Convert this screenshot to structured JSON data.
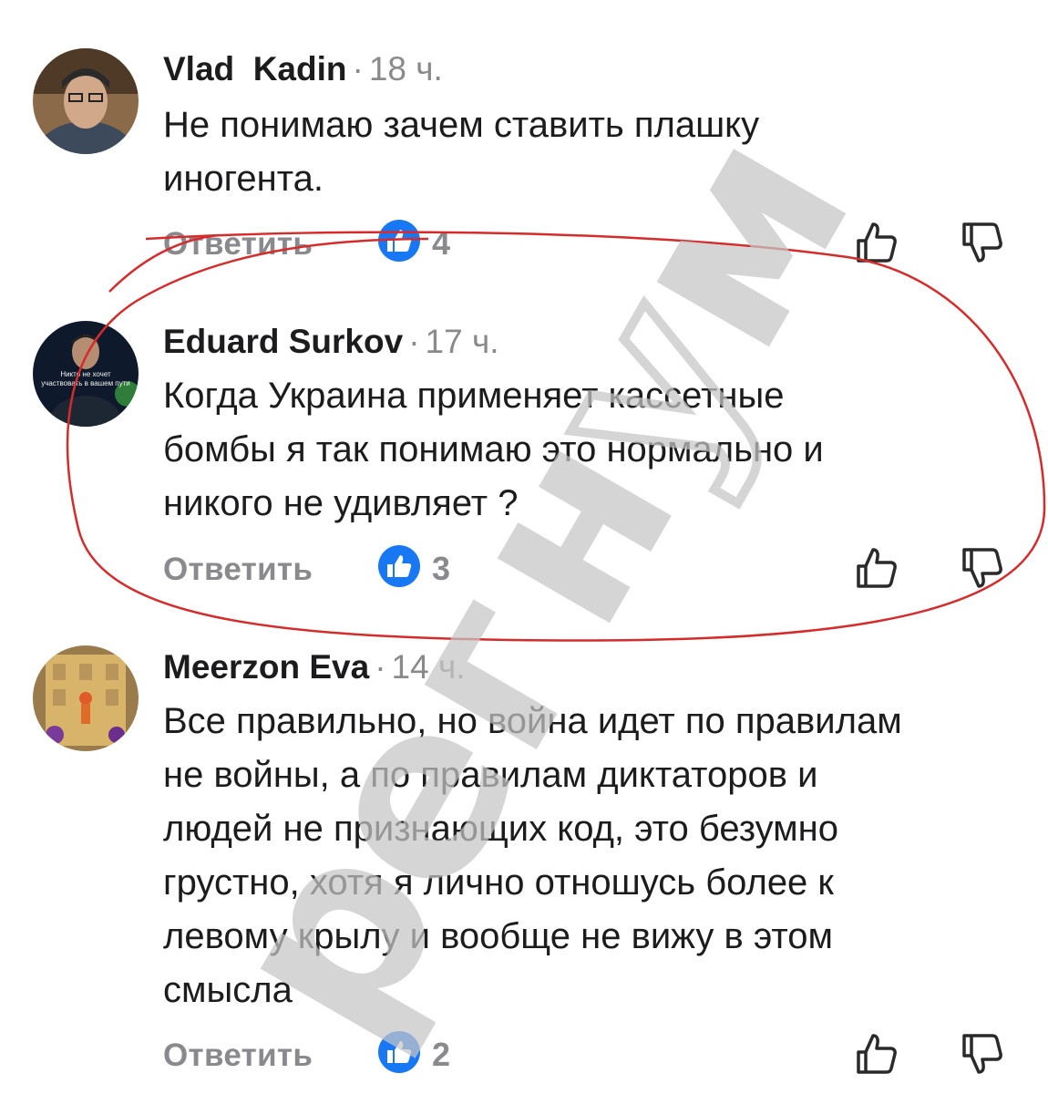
{
  "comments": [
    {
      "author": "Vlad  Kadin",
      "separator": "·",
      "time": "18 ч.",
      "lines": [
        "Не понимаю зачем ставить плашку",
        "иногента."
      ],
      "reply_label": "Ответить",
      "likes": "4"
    },
    {
      "author": "Eduard Surkov",
      "separator": "·",
      "time": "17 ч.",
      "lines": [
        "Когда Украина применяет кассетные",
        "бомбы я так понимаю это нормально и",
        "никого не удивляет ?"
      ],
      "reply_label": "Ответить",
      "likes": "3",
      "avatar_caption": "Никто не хочет участвовать в вашем пути"
    },
    {
      "author": "Meerzon Eva",
      "separator": "·",
      "time": "14 ч.",
      "lines": [
        "Все правильно, но война идет по правилам",
        "не войны, а по правилам диктаторов и",
        "людей не признающих код, это безумно",
        "грустно, хотя я лично отношусь более к",
        "левому крылу и вообще не вижу в этом",
        "смысла"
      ],
      "reply_label": "Ответить",
      "likes": "2"
    }
  ],
  "colors": {
    "accent_blue": "#1877f2",
    "muted_gray": "#8a8a8e",
    "highlight_red": "#d62b2b",
    "watermark_gray": "#c6c6c6"
  },
  "icons": {
    "like_badge": "thumbs-up-icon",
    "like_action": "thumbs-up-outline-icon",
    "dislike_action": "thumbs-down-outline-icon"
  },
  "watermark": {
    "letters": [
      "р",
      "е",
      "г",
      "н",
      "у",
      "м"
    ]
  }
}
